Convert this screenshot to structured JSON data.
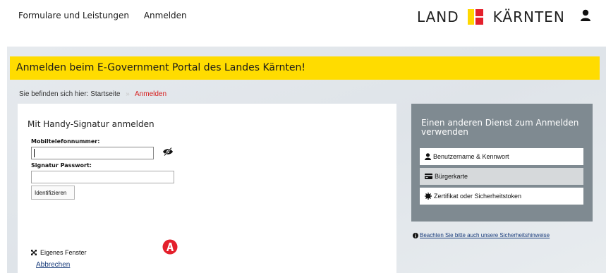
{
  "nav": {
    "items": [
      {
        "label": "Formulare und Leistungen"
      },
      {
        "label": "Anmelden"
      }
    ]
  },
  "brand": {
    "left": "LAND",
    "right": "KÄRNTEN",
    "colors": {
      "yellow": "#ffd800",
      "red": "#e4202c"
    }
  },
  "banner": {
    "title": "Anmelden beim E-Government Portal des Landes Kärnten!",
    "color": "#ffdc00"
  },
  "breadcrumb": {
    "prefix": "Sie befinden sich hier:",
    "home": "Startseite",
    "separator": "»",
    "current": "Anmelden"
  },
  "login": {
    "title": "Mit Handy-Signatur anmelden",
    "phone_label": "Mobiltelefonnummer:",
    "phone_value": "",
    "password_label": "Signatur Passwort:",
    "password_value": "",
    "submit_label": "Identifizieren",
    "own_window_label": "Eigenes Fenster",
    "cancel_label": "Abbrechen"
  },
  "other": {
    "title": "Einen anderen Dienst zum Anmelden verwenden",
    "options": [
      {
        "label": "Benutzername & Kennwort",
        "icon": "user-icon"
      },
      {
        "label": "Bürgerkarte",
        "icon": "card-icon"
      },
      {
        "label": "Zertifikat oder Sicherheitstoken",
        "icon": "certificate-icon"
      }
    ],
    "box_color": "#7f8a91"
  },
  "hint": {
    "label": "Beachten Sie bitte auch unsere Sicherheitshinweise",
    "icon": "info-icon"
  }
}
